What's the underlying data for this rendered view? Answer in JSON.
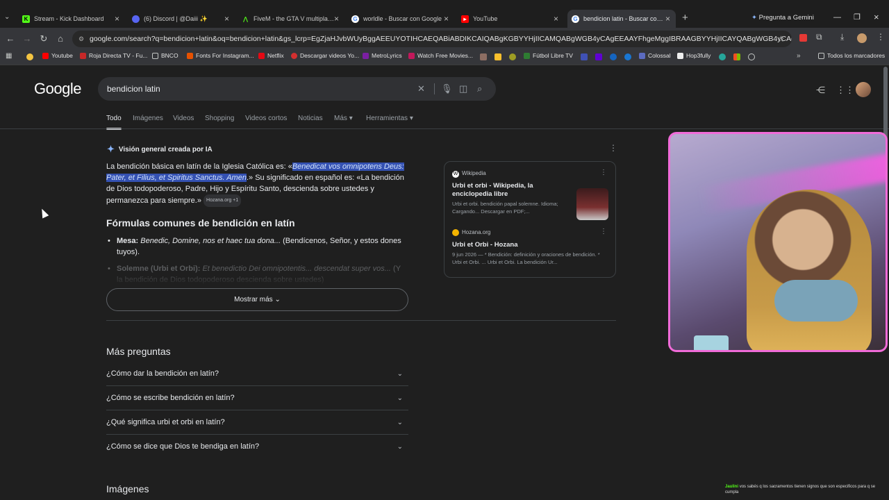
{
  "tabs": [
    {
      "title": "Stream - Kick Dashboard",
      "icon": "kick-icon",
      "color": "#53fc18"
    },
    {
      "title": "(6) Discord | @Daiii ✨",
      "icon": "discord-icon",
      "color": "#5865f2"
    },
    {
      "title": "FiveM - the GTA V multiplayer m",
      "icon": "fivem-icon",
      "color": "#f40552"
    },
    {
      "title": "worldle - Buscar con Google",
      "icon": "google-icon",
      "color": "#4285f4"
    },
    {
      "title": "YouTube",
      "icon": "youtube-icon",
      "color": "#ff0000"
    },
    {
      "title": "bendicion latin - Buscar con Go",
      "icon": "google-icon",
      "color": "#4285f4"
    }
  ],
  "gemini_label": "Pregunta a Gemini",
  "url": "google.com/search?q=bendicion+latin&oq=bendicion+latin&gs_lcrp=EgZjaHJvbWUyBggAEEUYOTIHCAEQABiABDIKCAIQABgKGBYYHjIICAMQABgWGB4yCAgEEAAYFhgeMggIBRAAGBYYHjIICAYQABgWGB4yCAgHEAAYFhgeMggICBAAGB",
  "bookmarks": [
    "Youtube",
    "Roja Directa TV - Fu...",
    "BNCO",
    "Fonts For Instagram...",
    "Netflix",
    "Descargar videos Yo...",
    "MetroLyrics",
    "Watch Free Movies...",
    "Fútbol Libre TV",
    "Colossal",
    "Hop3fully"
  ],
  "all_bookmarks": "Todos los marcadores",
  "logo": "Google",
  "query": "bendicion latin",
  "filters": [
    "Todo",
    "Imágenes",
    "Videos",
    "Shopping",
    "Videos cortos",
    "Noticias",
    "Más",
    "Herramientas"
  ],
  "ai": {
    "heading": "Visión general creada por IA",
    "p1_a": "La bendición básica en latín de la Iglesia Católica es: «",
    "p1_hl": "Benedicat vos omnipotens Deus: Pater, et Filius, et Spiritus Sanctus. Amen",
    "p1_b": ".» Su significado en español es: «La bendición de Dios todopoderoso, Padre, Hijo y Espíritu Santo, descienda sobre ustedes y permanezca para siempre.»",
    "chip": "Hozana.org +1",
    "h2": "Fórmulas comunes de bendición en latín",
    "b1_label": "Mesa:",
    "b1_it": "Benedic, Domine, nos et haec tua dona...",
    "b1_rest": "(Bendícenos, Señor, y estos dones tuyos).",
    "b2_label": "Solemne (Urbi et Orbi):",
    "b2_it": "Et benedictio Dei omnipotentis... descendat super vos...",
    "b2_rest": "(Y la bendición de Dios todopoderoso descienda sobre ustedes)",
    "show_more": "Mostrar más"
  },
  "sources": [
    {
      "site": "Wikipedia",
      "title": "Urbi et orbi - Wikipedia, la enciclopedia libre",
      "desc": "Urbi et orbi. bendición papal solemne. Idioma; Cargando... Descargar en PDF;..."
    },
    {
      "site": "Hozana.org",
      "title": "Urbi et Orbi - Hozana",
      "desc": "9 jun 2026 — * Bendición: definición y oraciones de bendición. * Urbi et Orbi. ... Urbi et Orbi. La bendición Ur..."
    }
  ],
  "more_questions": {
    "heading": "Más preguntas",
    "items": [
      "¿Cómo dar la bendición en latín?",
      "¿Cómo se escribe bendición en latín?",
      "¿Qué significa urbi et orbi en latín?",
      "¿Cómo se dice que Dios te bendiga en latín?"
    ]
  },
  "images_heading": "Imágenes",
  "chat": {
    "user": "Jaulini",
    "text": "vos sabés q los sacramentos tienen signos que son especificos para q se cumpla"
  }
}
